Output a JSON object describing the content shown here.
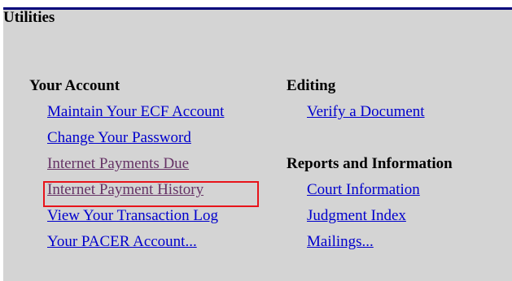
{
  "page": {
    "title": "Utilities"
  },
  "your_account": {
    "heading": "Your Account",
    "items": [
      {
        "label": "Maintain Your ECF Account",
        "state": "link"
      },
      {
        "label": "Change Your Password",
        "state": "link"
      },
      {
        "label": "Internet Payments Due",
        "state": "visited"
      },
      {
        "label": "Internet Payment History",
        "state": "visited",
        "highlighted": true
      },
      {
        "label": "View Your Transaction Log",
        "state": "link"
      },
      {
        "label": "Your PACER Account...",
        "state": "link"
      }
    ]
  },
  "editing": {
    "heading": "Editing",
    "items": [
      {
        "label": "Verify a Document",
        "state": "link"
      }
    ]
  },
  "reports": {
    "heading": "Reports and Information",
    "items": [
      {
        "label": "Court Information",
        "state": "link"
      },
      {
        "label": "Judgment Index",
        "state": "link"
      },
      {
        "label": "Mailings...",
        "state": "link"
      }
    ]
  },
  "colors": {
    "link": "#0000cc",
    "visited": "#663366",
    "highlight_border": "#e8131a",
    "panel_background": "#d4d4d4",
    "top_rule": "#00007a"
  }
}
